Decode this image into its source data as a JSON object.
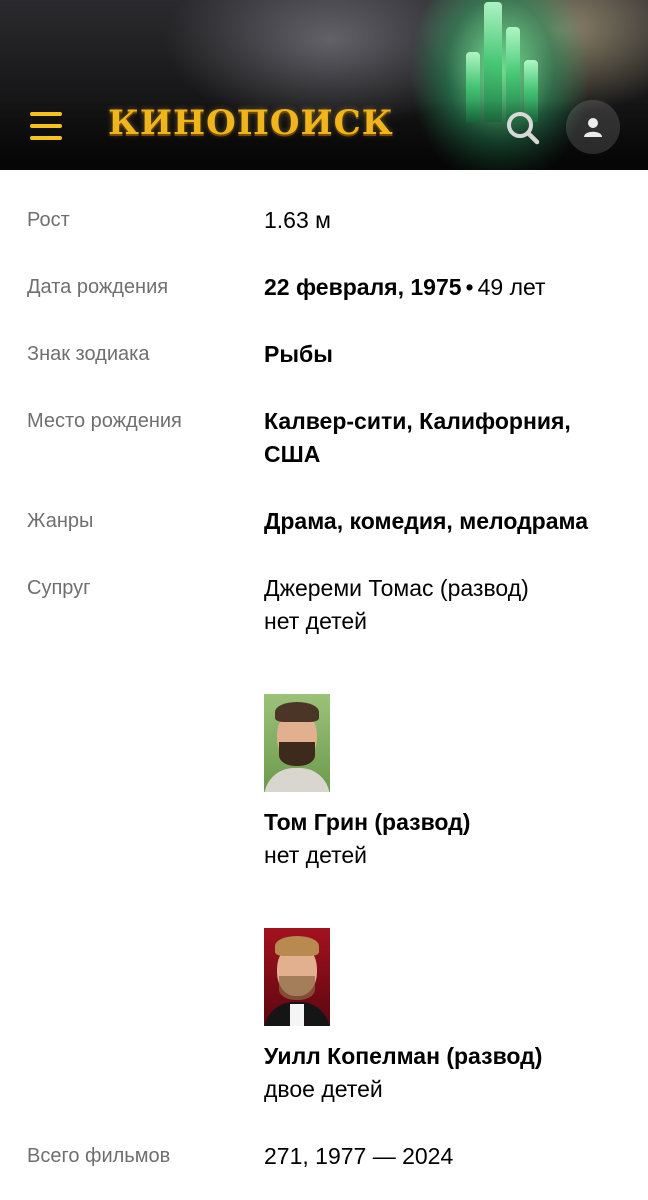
{
  "header": {
    "logo_text": "КИНОПОИСК",
    "menu_icon": "hamburger-menu-icon",
    "search_icon": "search-icon",
    "user_icon": "user-icon",
    "accent_color": "#f6c21b"
  },
  "details": {
    "height": {
      "label": "Рост",
      "value": "1.63 м"
    },
    "birth_date": {
      "label": "Дата рождения",
      "date": "22 февраля, 1975",
      "age": "49 лет"
    },
    "zodiac": {
      "label": "Знак зодиака",
      "value": "Рыбы"
    },
    "birth_place": {
      "label": "Место рождения",
      "line1": "Калвер-сити, Калифорния,",
      "line2": "США"
    },
    "genres": {
      "label": "Жанры",
      "value": "Драма, комедия, мелодрама"
    },
    "spouse": {
      "label": "Супруг",
      "items": [
        {
          "name": "Джереми Томас (развод)",
          "children": "нет детей",
          "has_photo": false
        },
        {
          "name": "Том Грин (развод)",
          "children": "нет детей",
          "has_photo": true
        },
        {
          "name": "Уилл Копелман (развод)",
          "children": "двое детей",
          "has_photo": true
        }
      ]
    },
    "films": {
      "label": "Всего фильмов",
      "value": "271, 1977 — 2024"
    }
  }
}
